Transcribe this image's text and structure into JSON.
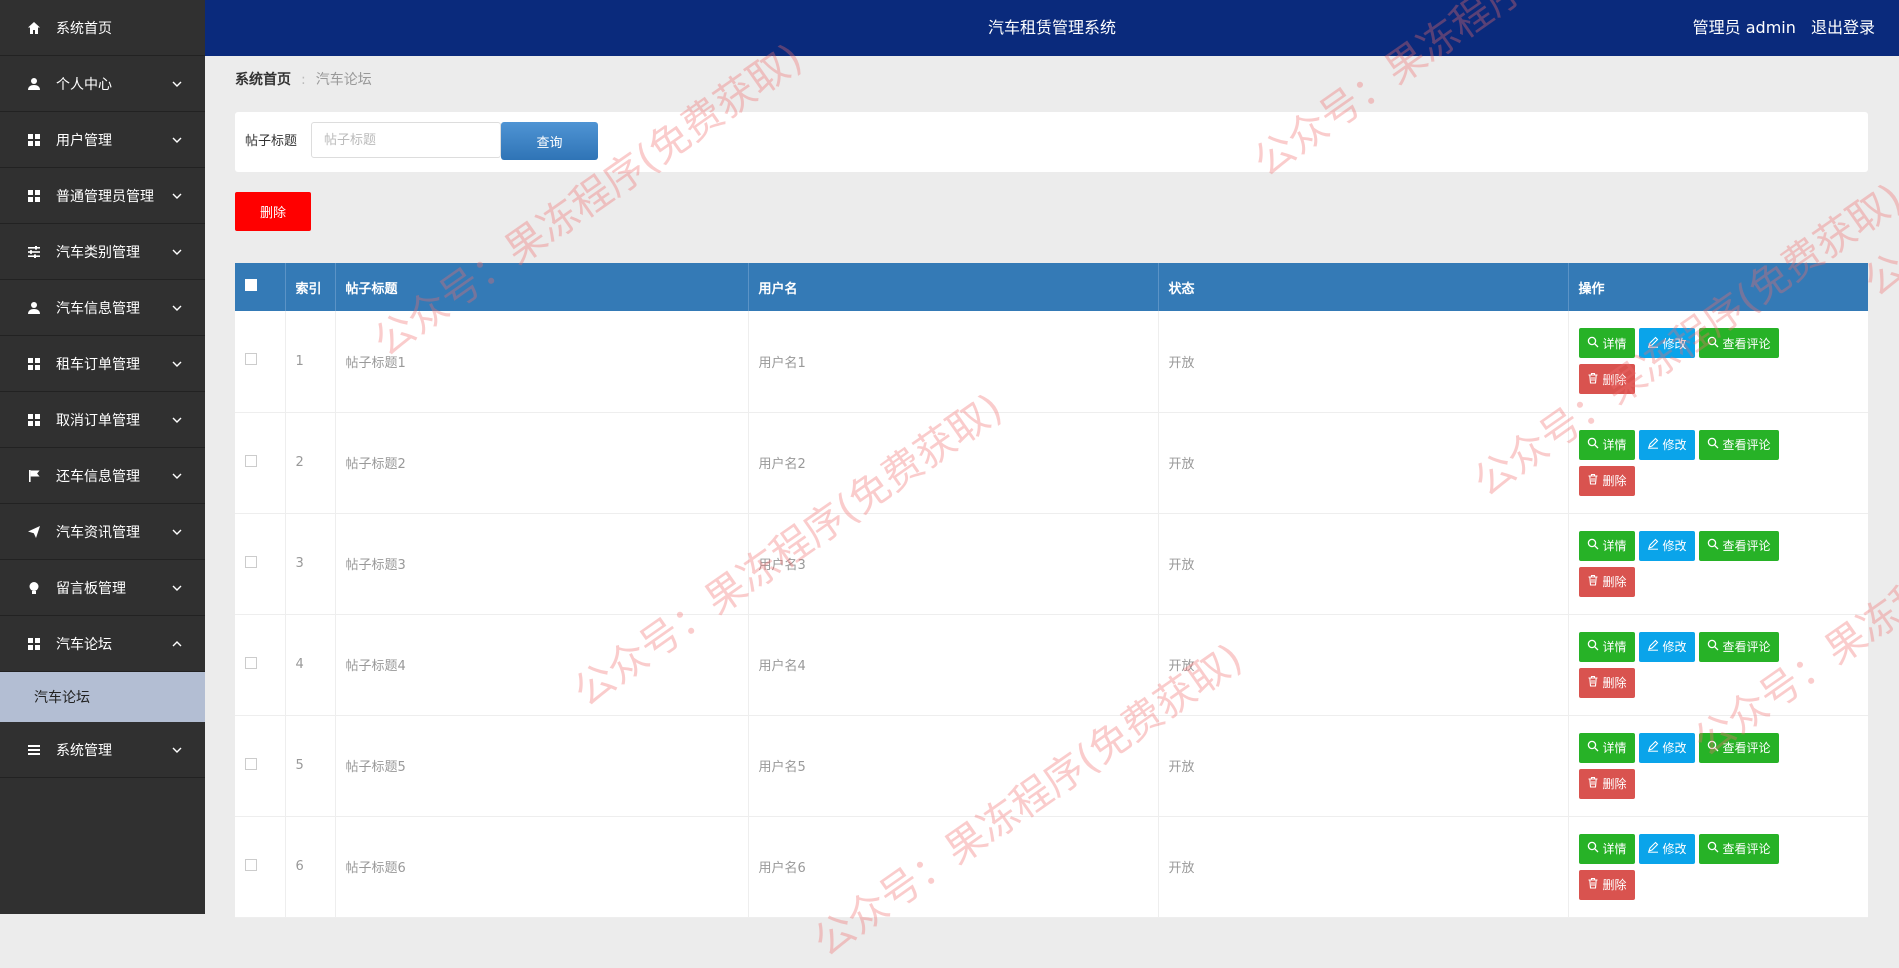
{
  "header": {
    "title": "汽车租赁管理系统",
    "user": "管理员 admin",
    "logout": "退出登录"
  },
  "sidebar": {
    "items": [
      {
        "label": "系统首页",
        "icon": "home-icon"
      },
      {
        "label": "个人中心",
        "icon": "user-icon"
      },
      {
        "label": "用户管理",
        "icon": "grid-icon"
      },
      {
        "label": "普通管理员管理",
        "icon": "grid-icon"
      },
      {
        "label": "汽车类别管理",
        "icon": "sliders-icon"
      },
      {
        "label": "汽车信息管理",
        "icon": "user-icon"
      },
      {
        "label": "租车订单管理",
        "icon": "grid-icon"
      },
      {
        "label": "取消订单管理",
        "icon": "grid-icon"
      },
      {
        "label": "还车信息管理",
        "icon": "flag-icon"
      },
      {
        "label": "汽车资讯管理",
        "icon": "send-icon"
      },
      {
        "label": "留言板管理",
        "icon": "bulb-icon"
      },
      {
        "label": "汽车论坛",
        "icon": "grid-icon",
        "expanded": true
      },
      {
        "label": "系统管理",
        "icon": "list-icon"
      }
    ],
    "sub_item": "汽车论坛"
  },
  "breadcrumb": {
    "home": "系统首页",
    "separator": ":",
    "current": "汽车论坛"
  },
  "search": {
    "label": "帖子标题",
    "placeholder": "帖子标题",
    "button": "查询"
  },
  "actions": {
    "delete": "删除"
  },
  "table": {
    "headers": {
      "index": "索引",
      "title": "帖子标题",
      "username": "用户名",
      "status": "状态",
      "ops": "操作"
    },
    "rows": [
      {
        "index": "1",
        "title": "帖子标题1",
        "username": "用户名1",
        "status": "开放"
      },
      {
        "index": "2",
        "title": "帖子标题2",
        "username": "用户名2",
        "status": "开放"
      },
      {
        "index": "3",
        "title": "帖子标题3",
        "username": "用户名3",
        "status": "开放"
      },
      {
        "index": "4",
        "title": "帖子标题4",
        "username": "用户名4",
        "status": "开放"
      },
      {
        "index": "5",
        "title": "帖子标题5",
        "username": "用户名5",
        "status": "开放"
      },
      {
        "index": "6",
        "title": "帖子标题6",
        "username": "用户名6",
        "status": "开放"
      }
    ],
    "op_labels": {
      "detail": "详情",
      "edit": "修改",
      "comments": "查看评论",
      "delete": "删除"
    }
  },
  "colors": {
    "header": "#0a2a7c",
    "sidebar": "#303030",
    "table_header": "#347ab6",
    "green": "#27b227",
    "blue": "#0aa4ea",
    "red": "#d9534f"
  },
  "watermark": "公众号：果冻程序(免费获取)"
}
